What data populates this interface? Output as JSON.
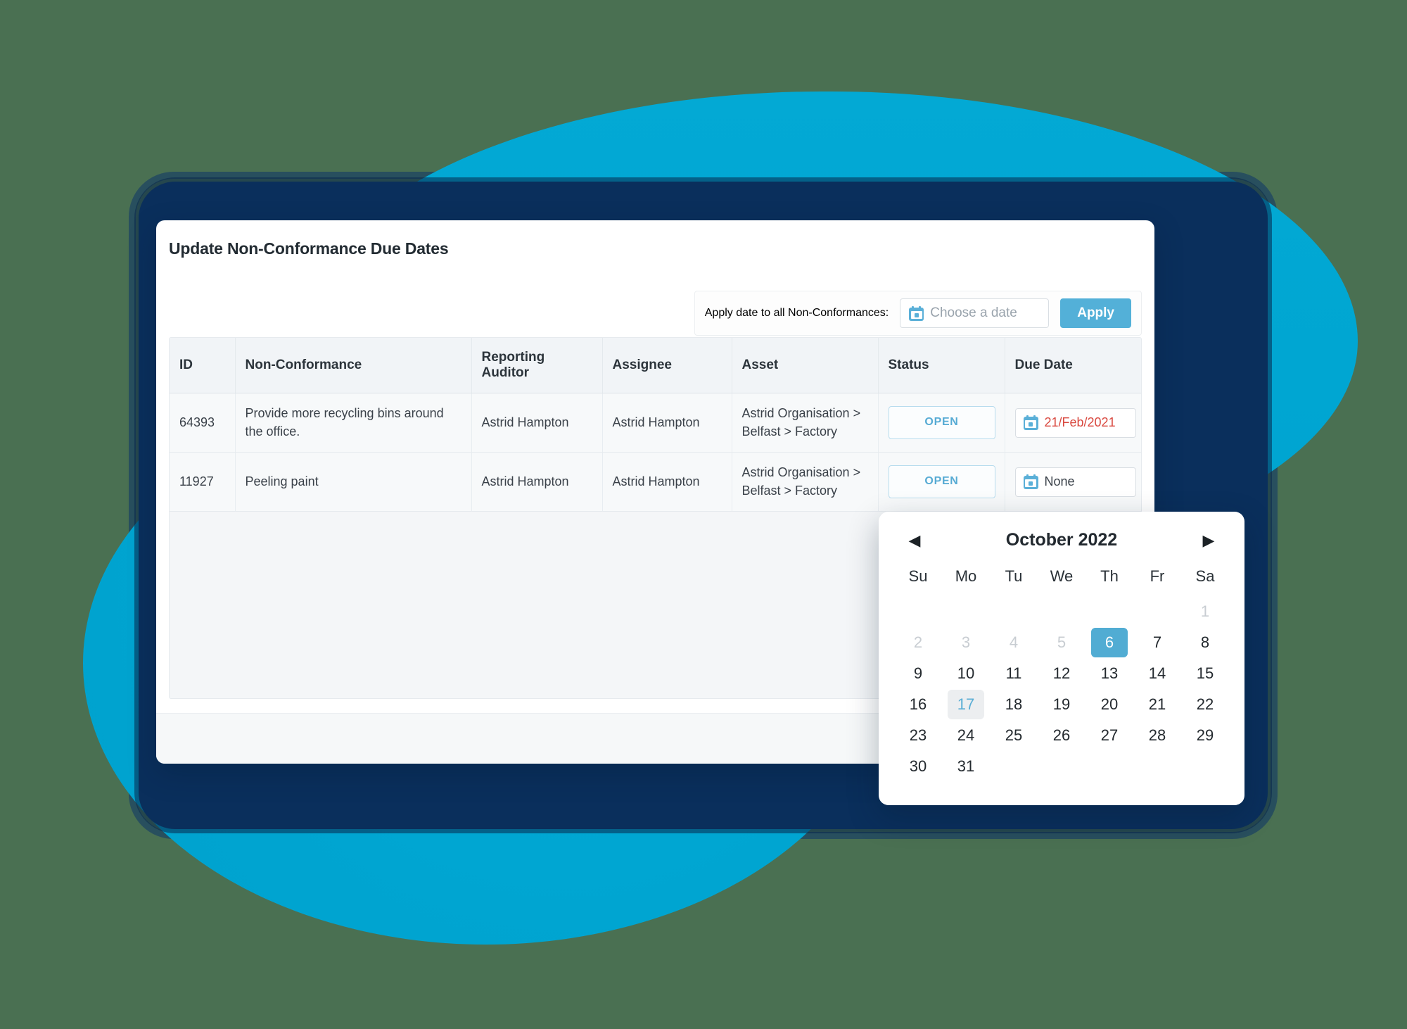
{
  "theme": {
    "page_background": "#4a7052",
    "blob_cyan": "#00a6d2",
    "navy_card": "#0a2f5c",
    "accent_blue": "#53b0d8",
    "overdue_red": "#d9483f"
  },
  "panel": {
    "title": "Update Non-Conformance Due Dates"
  },
  "apply_bar": {
    "label": "Apply date to all Non-Conformances:",
    "date_input": {
      "value": "",
      "placeholder": "Choose a date",
      "icon": "calendar-icon"
    },
    "apply_label": "Apply"
  },
  "table": {
    "columns": [
      "ID",
      "Non-Conformance",
      "Reporting Auditor",
      "Assignee",
      "Asset",
      "Status",
      "Due Date"
    ],
    "rows": [
      {
        "id": "64393",
        "non_conformance": "Provide more recycling bins around the office.",
        "reporting_auditor": "Astrid Hampton",
        "assignee": "Astrid Hampton",
        "asset": "Astrid Organisation > Belfast > Factory",
        "status": "OPEN",
        "due_date": "21/Feb/2021",
        "due_overdue": true
      },
      {
        "id": "11927",
        "non_conformance": "Peeling paint",
        "reporting_auditor": "Astrid Hampton",
        "assignee": "Astrid Hampton",
        "asset": "Astrid Organisation > Belfast > Factory",
        "status": "OPEN",
        "due_date": "None",
        "due_overdue": false
      }
    ]
  },
  "calendar": {
    "month_label": "October 2022",
    "prev_icon": "◀",
    "next_icon": "▶",
    "day_headers": [
      "Su",
      "Mo",
      "Tu",
      "We",
      "Th",
      "Fr",
      "Sa"
    ],
    "leading_blanks": 6,
    "days": [
      {
        "n": "1",
        "state": "muted"
      },
      {
        "n": "2",
        "state": "muted"
      },
      {
        "n": "3",
        "state": "muted"
      },
      {
        "n": "4",
        "state": "muted"
      },
      {
        "n": "5",
        "state": "muted"
      },
      {
        "n": "6",
        "state": "selected"
      },
      {
        "n": "7",
        "state": "normal"
      },
      {
        "n": "8",
        "state": "normal"
      },
      {
        "n": "9",
        "state": "normal"
      },
      {
        "n": "10",
        "state": "normal"
      },
      {
        "n": "11",
        "state": "normal"
      },
      {
        "n": "12",
        "state": "normal"
      },
      {
        "n": "13",
        "state": "normal"
      },
      {
        "n": "14",
        "state": "normal"
      },
      {
        "n": "15",
        "state": "normal"
      },
      {
        "n": "16",
        "state": "normal"
      },
      {
        "n": "17",
        "state": "today"
      },
      {
        "n": "18",
        "state": "normal"
      },
      {
        "n": "19",
        "state": "normal"
      },
      {
        "n": "20",
        "state": "normal"
      },
      {
        "n": "21",
        "state": "normal"
      },
      {
        "n": "22",
        "state": "normal"
      },
      {
        "n": "23",
        "state": "normal"
      },
      {
        "n": "24",
        "state": "normal"
      },
      {
        "n": "25",
        "state": "normal"
      },
      {
        "n": "26",
        "state": "normal"
      },
      {
        "n": "27",
        "state": "normal"
      },
      {
        "n": "28",
        "state": "normal"
      },
      {
        "n": "29",
        "state": "normal"
      },
      {
        "n": "30",
        "state": "normal"
      },
      {
        "n": "31",
        "state": "normal"
      }
    ]
  }
}
